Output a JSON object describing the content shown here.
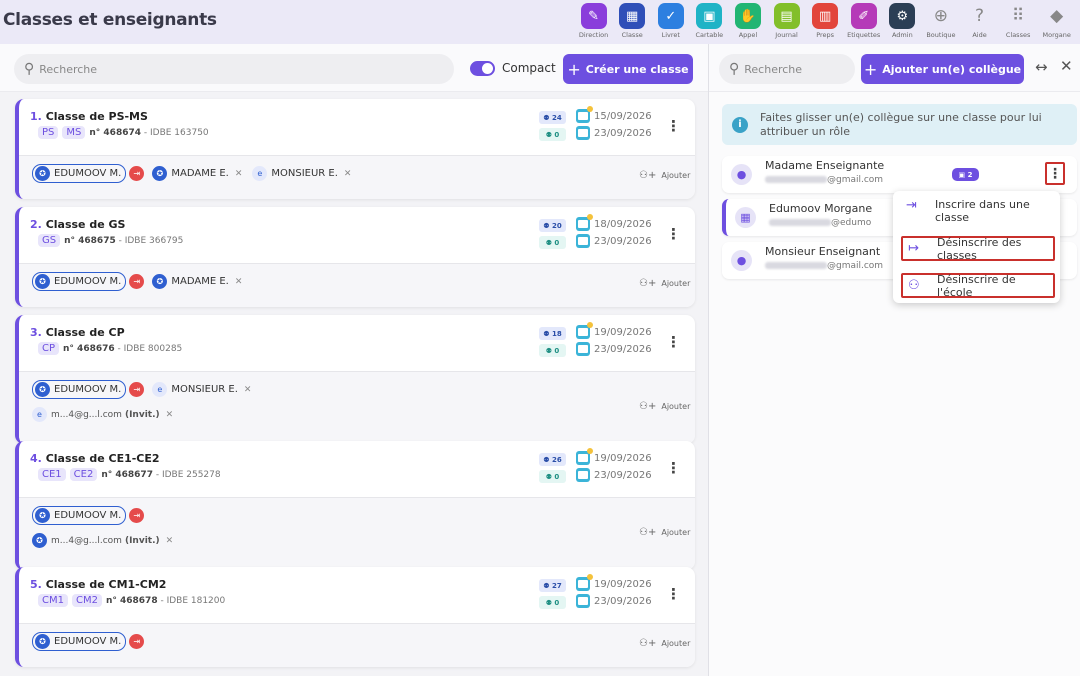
{
  "page": {
    "title": "Classes et enseignants"
  },
  "apps": [
    {
      "label": "Direction",
      "icon": "✎",
      "color": "#8a3ddb"
    },
    {
      "label": "Classe",
      "icon": "▦",
      "color": "#2f4fb8"
    },
    {
      "label": "Livret",
      "icon": "✓",
      "color": "#2d7fe0"
    },
    {
      "label": "Cartable",
      "icon": "▣",
      "color": "#1fb3c6"
    },
    {
      "label": "Appel",
      "icon": "✋",
      "color": "#22b573"
    },
    {
      "label": "Journal",
      "icon": "▤",
      "color": "#82bf2a"
    },
    {
      "label": "Preps",
      "icon": "▥",
      "color": "#e2453b"
    },
    {
      "label": "Etiquettes",
      "icon": "✐",
      "color": "#b53ab8"
    },
    {
      "label": "Admin",
      "icon": "⚙",
      "color": "#2b3e55"
    },
    {
      "label": "Boutique",
      "icon": "⊕",
      "color": ""
    },
    {
      "label": "Aide",
      "icon": "?",
      "color": ""
    },
    {
      "label": "Classes",
      "icon": "⠿",
      "color": ""
    },
    {
      "label": "Morgane",
      "icon": "◆",
      "color": ""
    }
  ],
  "left": {
    "search_placeholder": "Recherche",
    "compact_label": "Compact",
    "create_button": "Créer une classe",
    "add_label": "Ajouter"
  },
  "classes": [
    {
      "num": "1.",
      "name": "Classe de PS-MS",
      "levels": [
        "PS",
        "MS"
      ],
      "no": "n° 468674",
      "idbe": "- IDBE 163750",
      "pupils": "24",
      "pupils2": "0",
      "date1": "15/09/2026",
      "date2": "23/09/2026",
      "teachers": [
        {
          "name": "EDUMOOV M."
        },
        {
          "name": "MADAME E."
        },
        {
          "name": "MONSIEUR E."
        }
      ],
      "invites": []
    },
    {
      "num": "2.",
      "name": "Classe de GS",
      "levels": [
        "GS"
      ],
      "no": "n° 468675",
      "idbe": "- IDBE 366795",
      "pupils": "20",
      "pupils2": "0",
      "date1": "18/09/2026",
      "date2": "23/09/2026",
      "teachers": [
        {
          "name": "EDUMOOV M."
        },
        {
          "name": "MADAME E."
        }
      ],
      "invites": []
    },
    {
      "num": "3.",
      "name": "Classe de CP",
      "levels": [
        "CP"
      ],
      "no": "n° 468676",
      "idbe": "- IDBE 800285",
      "pupils": "18",
      "pupils2": "0",
      "date1": "19/09/2026",
      "date2": "23/09/2026",
      "teachers": [
        {
          "name": "EDUMOOV M."
        },
        {
          "name": "MONSIEUR E."
        }
      ],
      "invites": [
        {
          "email": "m...4@g...l.com",
          "tag": "(Invit.)"
        }
      ]
    },
    {
      "num": "4.",
      "name": "Classe de CE1-CE2",
      "levels": [
        "CE1",
        "CE2"
      ],
      "no": "n° 468677",
      "idbe": "- IDBE 255278",
      "pupils": "26",
      "pupils2": "0",
      "date1": "19/09/2026",
      "date2": "23/09/2026",
      "teachers": [
        {
          "name": "EDUMOOV M."
        }
      ],
      "invites": [
        {
          "email": "m...4@g...l.com",
          "tag": "(Invit.)"
        }
      ]
    },
    {
      "num": "5.",
      "name": "Classe de CM1-CM2",
      "levels": [
        "CM1",
        "CM2"
      ],
      "no": "n° 468678",
      "idbe": "- IDBE 181200",
      "pupils": "27",
      "pupils2": "0",
      "date1": "19/09/2026",
      "date2": "23/09/2026",
      "teachers": [
        {
          "name": "EDUMOOV M."
        }
      ],
      "invites": []
    }
  ],
  "right": {
    "search_placeholder": "Recherche",
    "add_button": "Ajouter un(e) collègue",
    "info_text": "Faites glisser un(e) collègue sur une classe pour lui attribuer un rôle",
    "colleagues": [
      {
        "name": "Madame Enseignante",
        "email_domain": "@gmail.com",
        "badge": "2"
      },
      {
        "name": "Edumoov Morgane",
        "email_domain": "@edumo"
      },
      {
        "name": "Monsieur Enseignant",
        "email_domain": "@gmail.com"
      }
    ],
    "menu": {
      "enroll": "Inscrire dans une classe",
      "unenroll_classes": "Désinscrire des classes",
      "unenroll_school": "Désinscrire de l'école"
    }
  },
  "colors": {
    "accent": "#6d4fe0",
    "highlight": "#c9302c",
    "info_bg": "#dff0f6"
  }
}
